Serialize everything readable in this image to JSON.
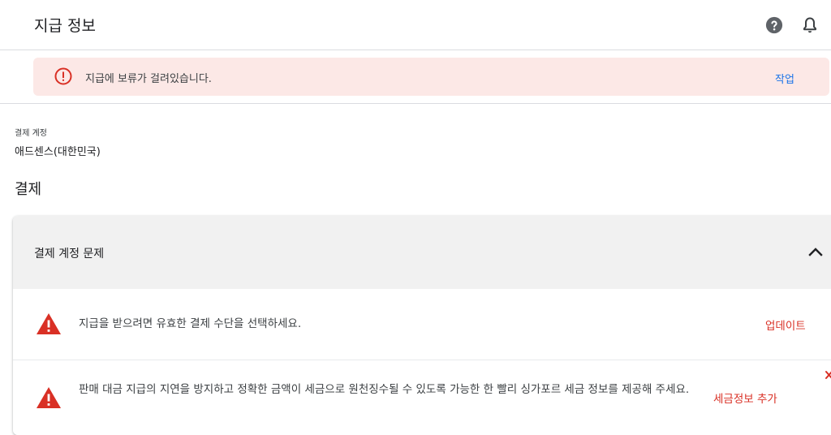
{
  "header": {
    "title": "지급 정보",
    "help_icon": "help-circle-icon",
    "notification_icon": "bell-icon"
  },
  "alert": {
    "icon": "error-circle-icon",
    "message": "지급에 보류가 걸려있습니다.",
    "action_label": "작업"
  },
  "account": {
    "label": "결제 계정",
    "value": "애드센스(대한민국)"
  },
  "payments_section": {
    "title": "결제",
    "card": {
      "title": "결제 계정 문제",
      "expanded": true,
      "issues": [
        {
          "icon": "warning-triangle-icon",
          "text": "지급을 받으려면 유효한 결제 수단을 선택하세요.",
          "action_label": "업데이트"
        },
        {
          "icon": "warning-triangle-icon",
          "text": "판매 대금 지급의 지연을 방지하고 정확한 금액이 세금으로 원천징수될 수 있도록 가능한 한 빨리 싱가포르 세금 정보를 제공해 주세요.",
          "action_label": "세금정보 추가"
        }
      ]
    }
  },
  "colors": {
    "alert_bg": "#fce8e6",
    "error": "#d93025",
    "link_blue": "#1a73e8",
    "card_header_bg": "#f1f1f1"
  }
}
